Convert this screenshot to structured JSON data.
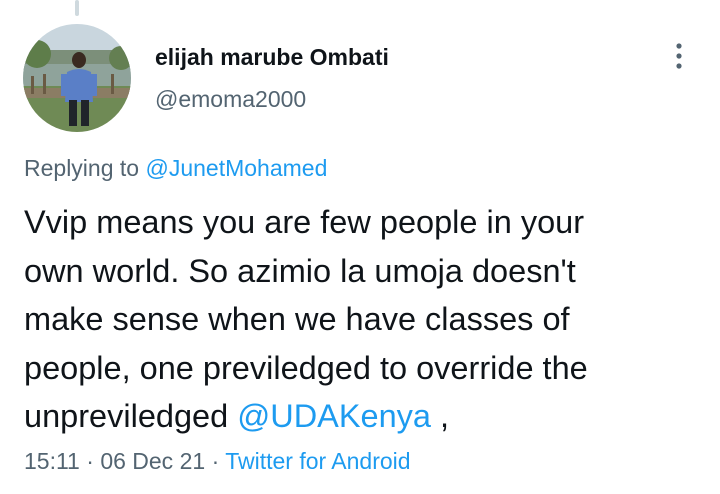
{
  "author": {
    "display_name": "elijah marube Ombati",
    "handle": "@emoma2000"
  },
  "reply": {
    "prefix": "Replying to",
    "to": "@JunetMohamed"
  },
  "body": {
    "lines": [
      "Vvip means you are few people in your",
      "own world. So azimio la umoja doesn't",
      "make sense when we have classes of",
      "people, one previledged to override the"
    ],
    "last_line_text": "unpreviledged",
    "last_line_mention": "@UDAKenya",
    "last_line_suffix": ","
  },
  "meta": {
    "time": "15:11",
    "separator": "·",
    "date": "06 Dec 21",
    "source": "Twitter for Android"
  },
  "icons": {
    "more": "more-vertical-icon"
  },
  "colors": {
    "text": "#0f1419",
    "secondary": "#536471",
    "link": "#1d9bf0"
  }
}
